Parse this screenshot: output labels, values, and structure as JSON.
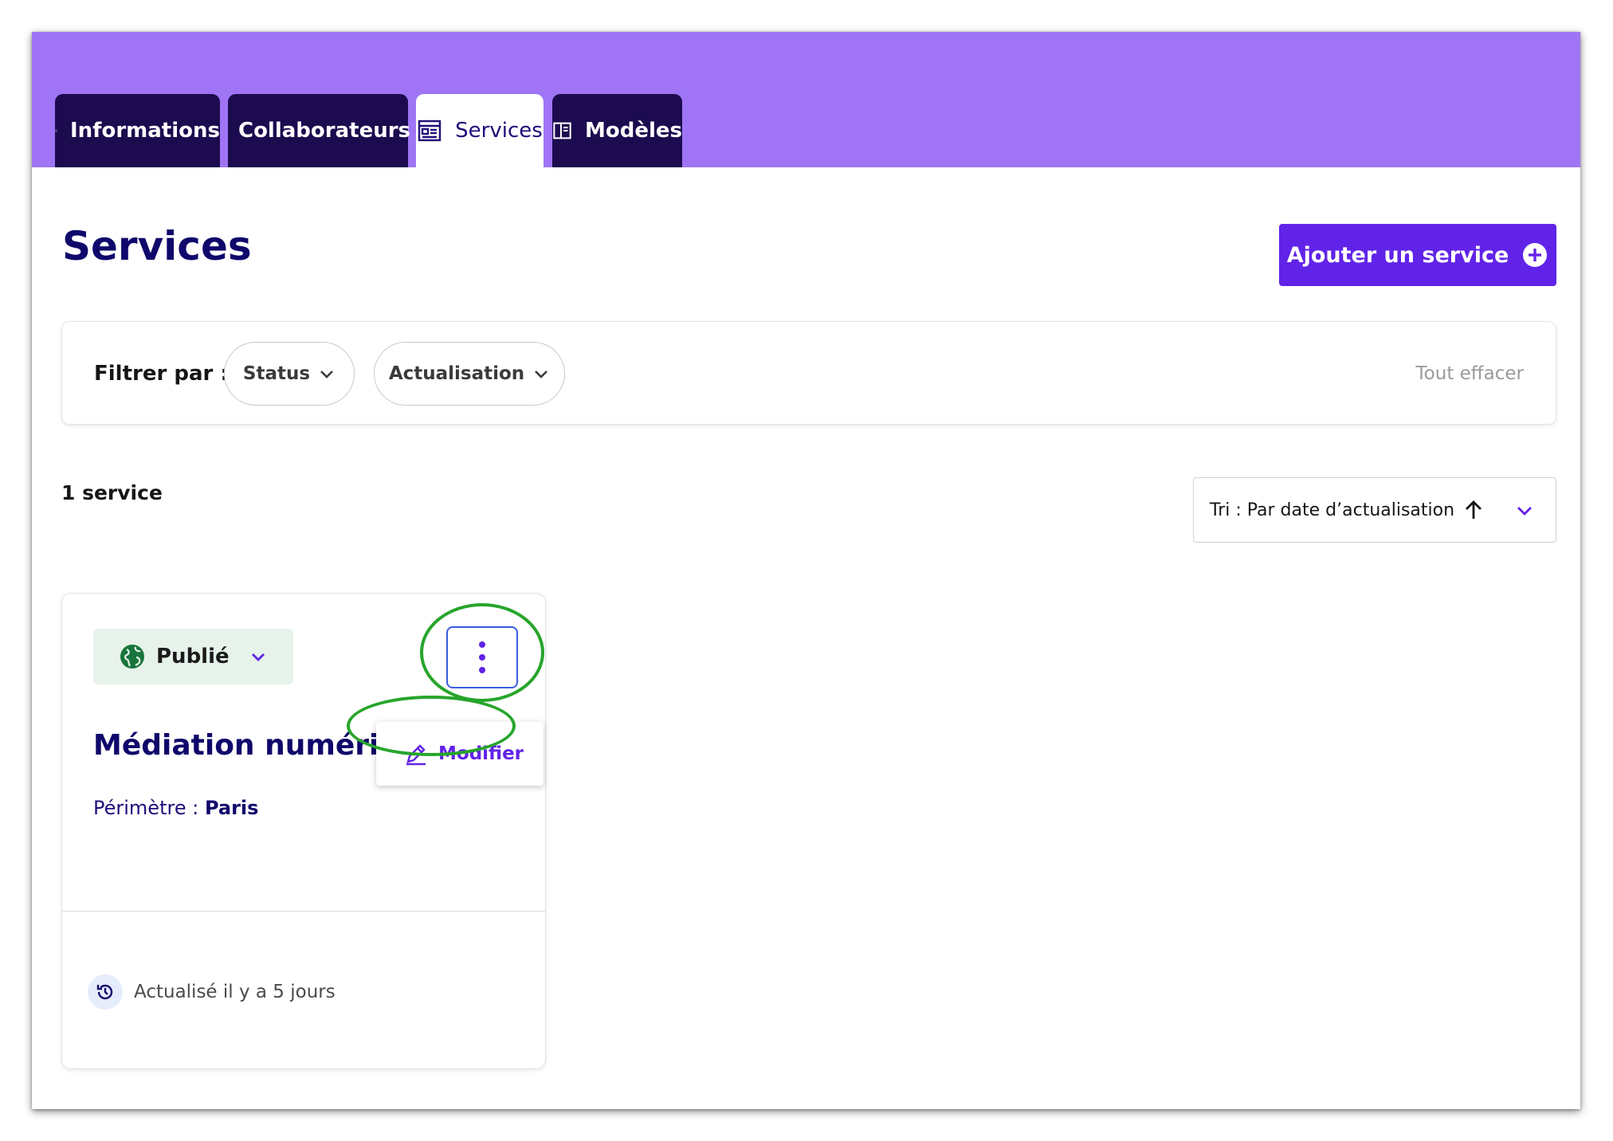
{
  "tabs": [
    {
      "label": "Informations",
      "icon": "info-icon",
      "active": false
    },
    {
      "label": "Collaborateurs",
      "icon": "users-icon",
      "active": false
    },
    {
      "label": "Services",
      "icon": "list-icon",
      "active": true
    },
    {
      "label": "Modèles",
      "icon": "template-icon",
      "active": false
    }
  ],
  "page": {
    "title": "Services",
    "add_button": "Ajouter un service"
  },
  "filters": {
    "label": "Filtrer par :",
    "status": "Status",
    "actualisation": "Actualisation",
    "clear": "Tout effacer"
  },
  "results": {
    "count": "1 service",
    "sort": "Tri : Par date d’actualisation"
  },
  "card": {
    "status": "Publié",
    "title": "Médiation numérique",
    "perimeter_label": "Périmètre :",
    "perimeter_value": "Paris",
    "updated": "Actualisé il y a 5 jours"
  },
  "menu": {
    "edit": "Modifier"
  },
  "colors": {
    "header": "#9f75f5",
    "tab_dark": "#1c0b4f",
    "primary": "#6123e8",
    "title": "#10076b",
    "published_bg": "#e6f2ea",
    "published_icon": "#18753c",
    "highlight_ring": "#27a52b"
  }
}
